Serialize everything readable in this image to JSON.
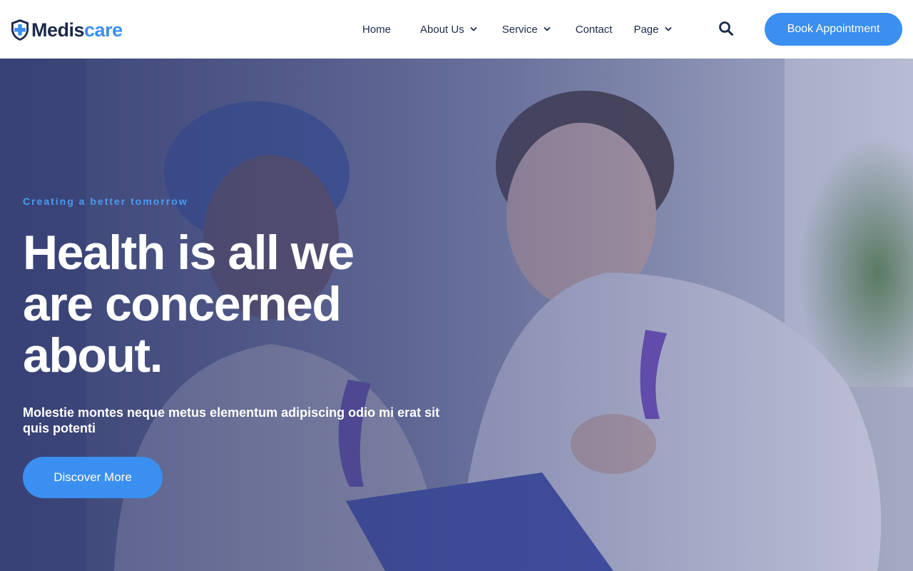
{
  "brand": {
    "name_part1": "Medis",
    "name_part2": "care",
    "logo_icon": "shield-cross-icon",
    "primary_color": "#3a8ff0",
    "dark_color": "#1c2a4a"
  },
  "nav": {
    "items": [
      {
        "label": "Home",
        "has_dropdown": false
      },
      {
        "label": "About Us",
        "has_dropdown": true
      },
      {
        "label": "Service",
        "has_dropdown": true
      },
      {
        "label": "Contact",
        "has_dropdown": false
      },
      {
        "label": "Page",
        "has_dropdown": true
      }
    ],
    "search_icon": "search-icon",
    "cta_label": "Book Appointment"
  },
  "hero": {
    "eyebrow": "Creating a better tomorrow",
    "headline_line1": "Health is all we",
    "headline_line2": "are concerned",
    "headline_line3": "about.",
    "subline": "Molestie montes neque metus elementum adipiscing odio mi erat sit quis potenti",
    "cta_label": "Discover More",
    "overlay_color": "#343e78"
  }
}
